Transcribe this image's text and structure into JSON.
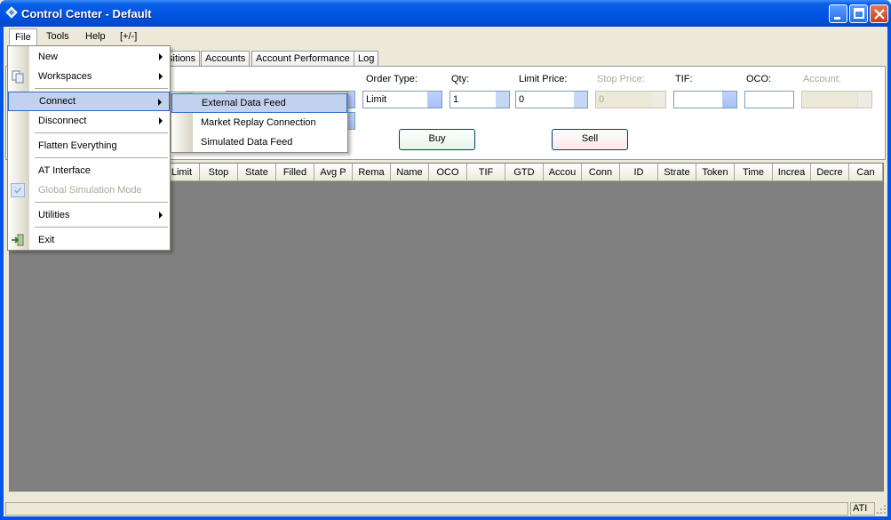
{
  "window": {
    "title": "Control Center - Default",
    "icon": "diamond-app-icon"
  },
  "menubar": {
    "items": [
      {
        "label": "File"
      },
      {
        "label": "Tools"
      },
      {
        "label": "Help"
      },
      {
        "label": "[+/-]"
      }
    ]
  },
  "tabs": [
    {
      "label": "sitions"
    },
    {
      "label": "Accounts"
    },
    {
      "label": "Account Performance"
    },
    {
      "label": "Log"
    }
  ],
  "order_entry": {
    "order_type_label": "Order Type:",
    "order_type_value": "Limit",
    "qty_label": "Qty:",
    "qty_value": "1",
    "limit_price_label": "Limit Price:",
    "limit_price_value": "0",
    "stop_price_label": "Stop Price:",
    "stop_price_value": "0",
    "tif_label": "TIF:",
    "tif_value": "",
    "oco_label": "OCO:",
    "oco_value": "",
    "account_label": "Account:",
    "account_value": "",
    "buy_label": "Buy",
    "sell_label": "Sell"
  },
  "grid": {
    "columns": [
      "Limit",
      "Stop",
      "State",
      "Filled",
      "Avg P",
      "Rema",
      "Name",
      "OCO",
      "TIF",
      "GTD",
      "Accou",
      "Conn",
      "ID",
      "Strate",
      "Token",
      "Time",
      "Increa",
      "Decre",
      "Can"
    ]
  },
  "file_menu": {
    "items": [
      {
        "label": "New",
        "submenu": true
      },
      {
        "label": "Workspaces",
        "submenu": true,
        "icon": "copy-icon"
      },
      {
        "label": "Connect",
        "submenu": true,
        "highlighted": true
      },
      {
        "label": "Disconnect",
        "submenu": true
      },
      {
        "label": "Flatten Everything"
      },
      {
        "label": "AT Interface"
      },
      {
        "label": "Global Simulation Mode",
        "disabled": true,
        "checked": true,
        "icon": "check-icon"
      },
      {
        "label": "Utilities",
        "submenu": true
      },
      {
        "label": "Exit",
        "icon": "exit-icon"
      }
    ]
  },
  "connect_submenu": {
    "items": [
      {
        "label": "External Data Feed",
        "highlighted": true
      },
      {
        "label": "Market Replay Connection"
      },
      {
        "label": "Simulated Data Feed"
      }
    ]
  },
  "statusbar": {
    "text": "ATI"
  },
  "colors": {
    "titlebar": "#0054E3",
    "menu_highlight": "#C1D2EE",
    "menu_highlight_border": "#316AC5",
    "grid_background": "#808080",
    "buy_button": "#E5F4E7",
    "sell_button": "#F9E6EA"
  }
}
